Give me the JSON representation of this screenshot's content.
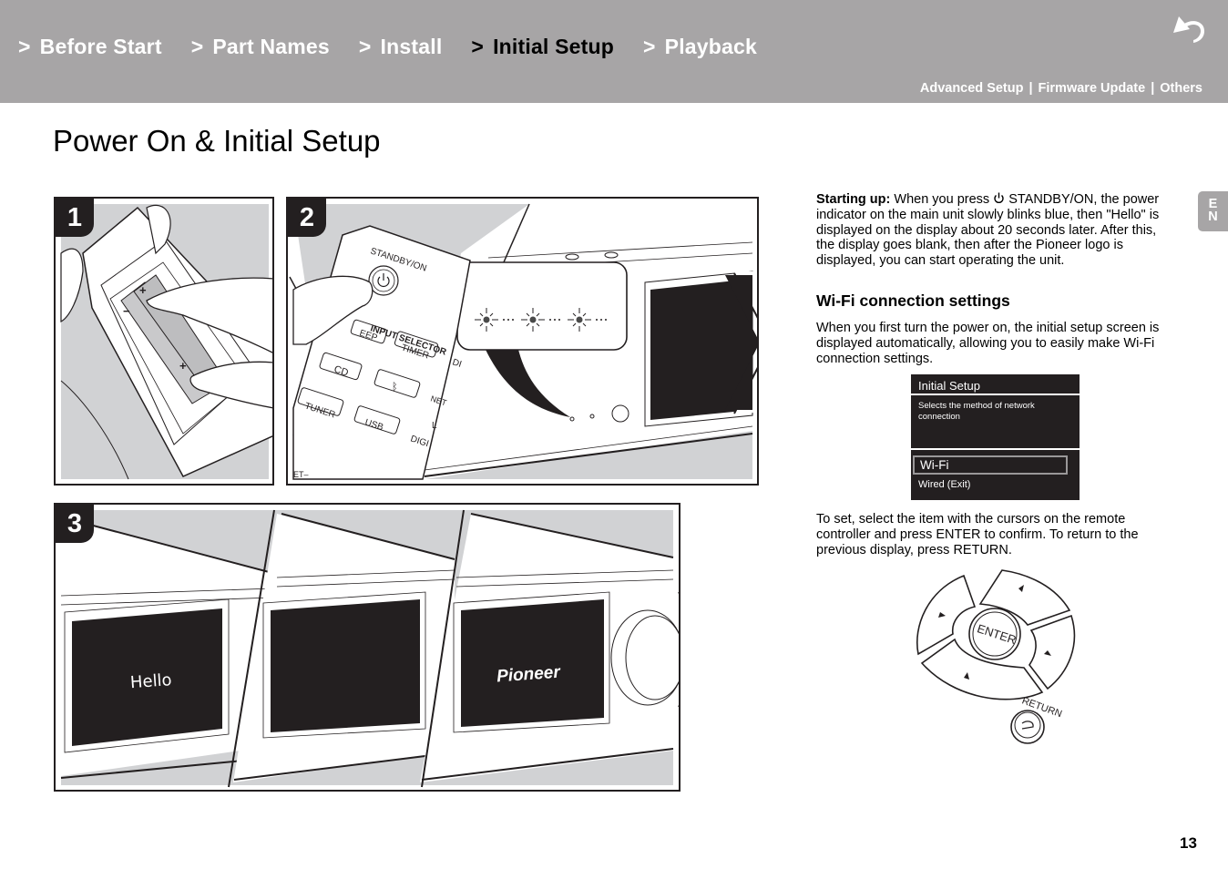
{
  "header": {
    "nav": [
      {
        "chevron": ">",
        "label": "Before Start",
        "active": false
      },
      {
        "chevron": ">",
        "label": "Part Names",
        "active": false
      },
      {
        "chevron": ">",
        "label": "Install",
        "active": false
      },
      {
        "chevron": ">",
        "label": "Initial Setup",
        "active": true
      },
      {
        "chevron": ">",
        "label": "Playback",
        "active": false
      }
    ],
    "back_icon": "return-arrow-icon",
    "subnav": [
      {
        "label": "Advanced Setup"
      },
      {
        "label": "Firmware Update"
      },
      {
        "label": "Others"
      }
    ],
    "subnav_separator": "|"
  },
  "page_title": "Power On & Initial Setup",
  "figures": {
    "step1": {
      "badge": "1"
    },
    "step2": {
      "badge": "2",
      "remote_labels": {
        "standby": "STANDBY/ON",
        "sleep": "EEP",
        "timer": "TIMER",
        "dim": "DI",
        "input_selector": "INPUT SELECTOR",
        "cd": "CD",
        "net": "NET",
        "tuner": "TUNER",
        "usb": "USB",
        "digi": "DIGI",
        "l": "L",
        "et": "ET–"
      }
    },
    "step3": {
      "badge": "3",
      "display1_text": "Hello",
      "display3_logo": "Pioneer"
    }
  },
  "content": {
    "starting_up_label": "Starting up:",
    "starting_up_pre": " When you press ",
    "power_icon": "power-icon",
    "starting_up_post": " STANDBY/ON, the power indicator on the main unit slowly blinks blue, then \"Hello\" is displayed on the display about 20 seconds later. After this, the display goes blank, then after the Pioneer logo is displayed, you can start operating the unit.",
    "wifi_heading": "Wi-Fi connection settings",
    "wifi_paragraph": "When you first turn the power on, the initial setup screen is displayed automatically, allowing you to easily make Wi-Fi connection settings.",
    "osd": {
      "title": "Initial Setup",
      "description": "Selects the method of network connection",
      "options": [
        {
          "label": "Wi-Fi",
          "selected": true
        },
        {
          "label": "Wired (Exit)",
          "selected": false
        }
      ]
    },
    "instruction": "To set, select the item with the cursors on the remote controller and press ENTER to confirm. To return to the previous display, press RETURN.",
    "remote_diagram": {
      "enter_label": "ENTER",
      "return_label": "RETURN"
    }
  },
  "lang_tab": {
    "line1": "E",
    "line2": "N"
  },
  "page_number": "13",
  "colors": {
    "header_bg": "#a7a5a6",
    "panel_gray": "#d1d2d4",
    "dark": "#231f20"
  }
}
